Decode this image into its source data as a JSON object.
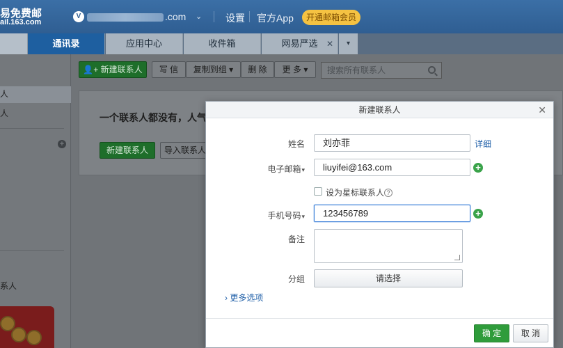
{
  "header": {
    "logo_line1": "易免费邮",
    "logo_line2": "ail.163.com",
    "avatar_letter": "V",
    "account_suffix": ".com",
    "links": [
      "设置",
      "官方App"
    ],
    "vip_label": "开通邮箱会员"
  },
  "tabs": [
    {
      "label": "通讯录",
      "active": true
    },
    {
      "label": "应用中心",
      "active": false
    },
    {
      "label": "收件箱",
      "active": false
    },
    {
      "label": "网易严选",
      "active": false,
      "closable": true
    }
  ],
  "sidebar": {
    "item_selected": "人",
    "item_2": "人",
    "item_bottom": "系人"
  },
  "toolbar": {
    "new_contact": "新建联系人",
    "write": "写 信",
    "copy_to_group": "复制到组",
    "delete": "删 除",
    "more": "更 多",
    "search_placeholder": "搜索所有联系人"
  },
  "empty": {
    "tip": "一个联系人都没有，人气",
    "new_contact": "新建联系人",
    "import_contact": "导入联系人"
  },
  "dialog": {
    "title": "新建联系人",
    "name_label": "姓名",
    "name_value": "刘亦菲",
    "detail_link": "详细",
    "email_label": "电子邮箱",
    "email_value": "liuyifei@163.com",
    "star_label": "设为星标联系人",
    "phone_label": "手机号码",
    "phone_value": "123456789",
    "note_label": "备注",
    "group_label": "分组",
    "group_select": "请选择",
    "more_options": "更多选项",
    "ok": "确 定",
    "cancel": "取 消"
  }
}
